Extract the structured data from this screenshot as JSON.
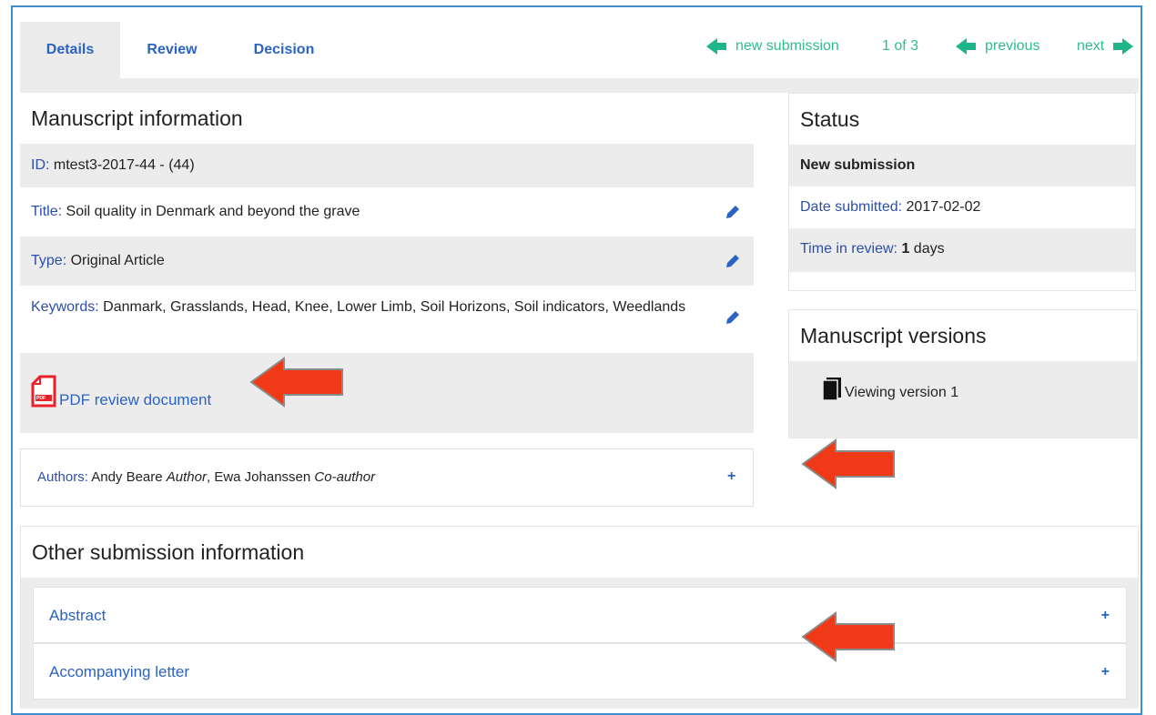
{
  "tabs": {
    "details": "Details",
    "review": "Review",
    "decision": "Decision"
  },
  "nav": {
    "new_submission": "new submission",
    "count": "1 of 3",
    "previous": "previous",
    "next": "next"
  },
  "manuscript": {
    "title": "Manuscript information",
    "id_label": "ID:",
    "id_value": "mtest3-2017-44 - (44)",
    "title_label": "Title:",
    "title_value": "Soil quality in Denmark and beyond the grave",
    "type_label": "Type:",
    "type_value": "Original Article",
    "keywords_label": "Keywords:",
    "keywords_value": "Danmark, Grasslands, Head, Knee, Lower Limb, Soil Horizons, Soil indicators, Weedlands",
    "pdf_link": "PDF review document",
    "pdf_icon_text": "PDF"
  },
  "authors": {
    "label": "Authors:",
    "author1_name": "Andy Beare",
    "author1_role": "Author",
    "author2_name": "Ewa Johanssen",
    "author2_role": "Co-author",
    "expand": "+"
  },
  "status": {
    "title": "Status",
    "state": "New submission",
    "date_label": "Date submitted:",
    "date_value": "2017-02-02",
    "time_label": "Time in review:",
    "time_value": "1",
    "time_unit": "days"
  },
  "versions": {
    "title": "Manuscript versions",
    "viewing": "Viewing version 1"
  },
  "other": {
    "title": "Other submission information",
    "items": [
      {
        "label": "Abstract",
        "expand": "+"
      },
      {
        "label": "Accompanying letter",
        "expand": "+"
      }
    ]
  },
  "colors": {
    "link_blue": "#2a63c4",
    "nav_green": "#2ebd91",
    "annotation_red": "#f03a17",
    "panel_grey": "#ececec"
  }
}
